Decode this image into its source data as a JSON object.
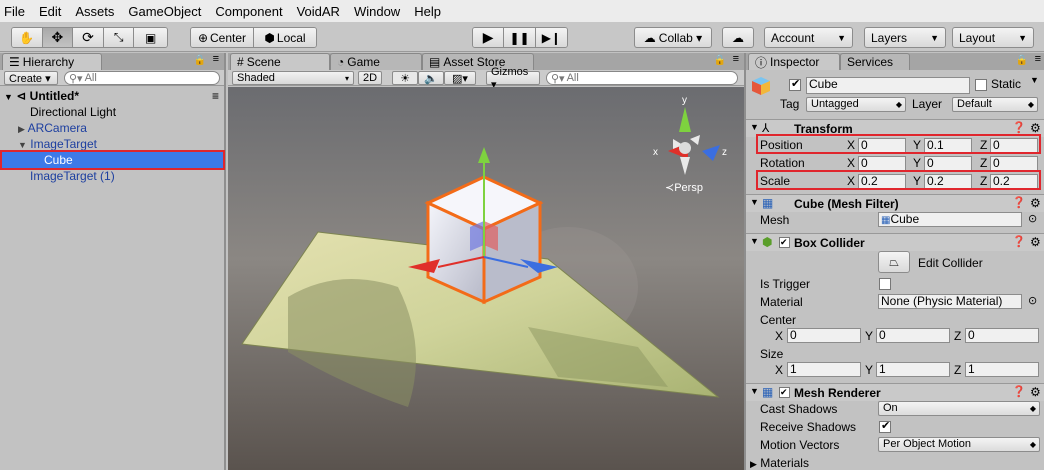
{
  "menu": [
    "File",
    "Edit",
    "Assets",
    "GameObject",
    "Component",
    "VoidAR",
    "Window",
    "Help"
  ],
  "toolbar": {
    "center": "Center",
    "local": "Local",
    "collab": "Collab ▾",
    "account": "Account",
    "layers": "Layers",
    "layout": "Layout"
  },
  "hierarchy": {
    "tab": "Hierarchy",
    "create": "Create ▾",
    "search": "All",
    "scene": "Untitled*",
    "items": [
      "Directional Light",
      "ARCamera",
      "ImageTarget",
      "Cube",
      "ImageTarget (1)"
    ]
  },
  "scene": {
    "tabs": [
      "Scene",
      "Game",
      "Asset Store"
    ],
    "shading": "Shaded",
    "mode2d": "2D",
    "gizmos": "Gizmos ▾",
    "search": "All",
    "persp": "Persp",
    "axis_x": "x",
    "axis_y": "y",
    "axis_z": "z"
  },
  "inspector": {
    "tabs": [
      "Inspector",
      "Services"
    ],
    "name": "Cube",
    "static": "Static",
    "tag_label": "Tag",
    "tag": "Untagged",
    "layer_label": "Layer",
    "layer": "Default",
    "transform": {
      "title": "Transform",
      "position_label": "Position",
      "rotation_label": "Rotation",
      "scale_label": "Scale",
      "position": {
        "x": "0",
        "y": "0.1",
        "z": "0"
      },
      "rotation": {
        "x": "0",
        "y": "0",
        "z": "0"
      },
      "scale": {
        "x": "0.2",
        "y": "0.2",
        "z": "0.2"
      }
    },
    "mesh_filter": {
      "title": "Cube (Mesh Filter)",
      "mesh_label": "Mesh",
      "mesh": "Cube"
    },
    "box_collider": {
      "title": "Box Collider",
      "edit": "Edit Collider",
      "is_trigger": "Is Trigger",
      "material_label": "Material",
      "material": "None (Physic Material)",
      "center_label": "Center",
      "center": {
        "x": "0",
        "y": "0",
        "z": "0"
      },
      "size_label": "Size",
      "size": {
        "x": "1",
        "y": "1",
        "z": "1"
      }
    },
    "mesh_renderer": {
      "title": "Mesh Renderer",
      "cast_label": "Cast Shadows",
      "cast": "On",
      "receive_label": "Receive Shadows",
      "motion_label": "Motion Vectors",
      "motion": "Per Object Motion",
      "materials": "Materials"
    },
    "axis": {
      "x": "X",
      "y": "Y",
      "z": "Z"
    }
  },
  "colors": {
    "highlight": "#e0262d",
    "selection": "#3d7ae8"
  }
}
